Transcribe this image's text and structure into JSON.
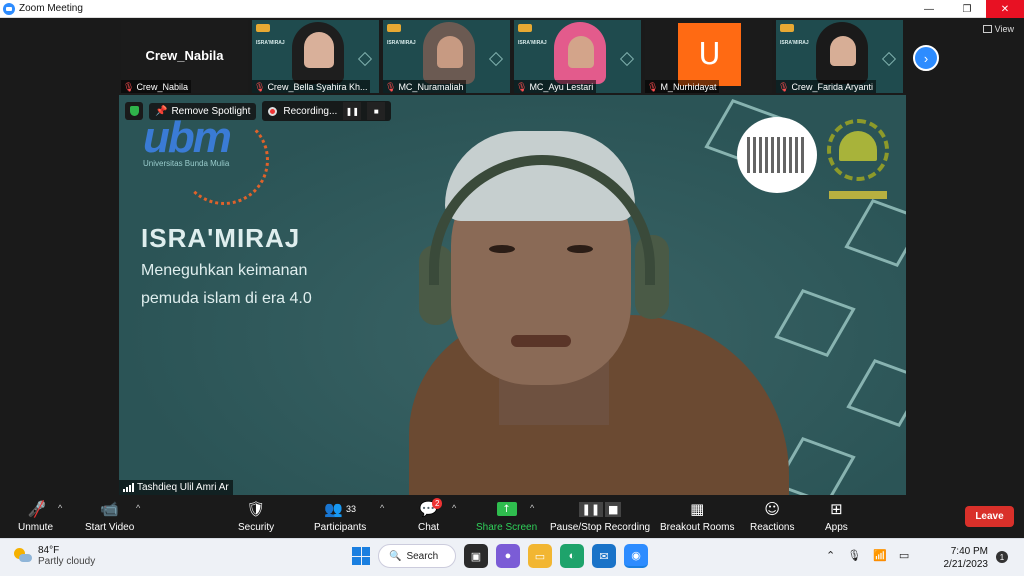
{
  "window": {
    "title": "Zoom Meeting",
    "minimize": "—",
    "maximize": "❐",
    "close": "✕"
  },
  "view_button": {
    "label": "View"
  },
  "thumbnails": [
    {
      "name": "Crew_Nabila",
      "label": "Crew_Nabila",
      "muted": true
    },
    {
      "name": "Crew_Bella Syahira Kh...",
      "muted": true
    },
    {
      "name": "MC_Nuramaliah",
      "muted": true
    },
    {
      "name": "MC_Ayu Lestari",
      "muted": true
    },
    {
      "name": "M_Nurhidayat",
      "avatar_letter": "U",
      "muted": true
    },
    {
      "name": "Crew_Farida Aryanti",
      "muted": true
    }
  ],
  "slide_thumb_text": "ISRA'MIRAJ",
  "next_page_icon": "›",
  "spotlight": {
    "remove_label": "Remove Spotlight",
    "recording_label": "Recording...",
    "pause_icon": "❚❚",
    "stop_icon": "■"
  },
  "main_video": {
    "speaker_name": "Tashdieq Ulil Amri Ar",
    "slide": {
      "logo_text": "ubm",
      "logo_sub": "Universitas Bunda Mulia",
      "title": "ISRA'MIRAJ",
      "subtitle_line1": "Meneguhkan keimanan",
      "subtitle_line2": "pemuda islam di era 4.0"
    }
  },
  "toolbar": {
    "unmute": "Unmute",
    "start_video": "Start Video",
    "security": "Security",
    "participants": "Participants",
    "participants_count": "33",
    "chat": "Chat",
    "chat_badge": "2",
    "share_screen": "Share Screen",
    "pause_stop_recording": "Pause/Stop Recording",
    "breakout_rooms": "Breakout Rooms",
    "reactions": "Reactions",
    "apps": "Apps",
    "leave": "Leave",
    "caret": "^"
  },
  "taskbar": {
    "temperature": "84°F",
    "weather": "Partly cloudy",
    "search_label": "Search",
    "time": "7:40 PM",
    "date": "2/21/2023",
    "notification_count": "1"
  },
  "colors": {
    "zoom_blue": "#2d8cff",
    "leave_red": "#d9302a",
    "share_green": "#2fbd4e",
    "slide_teal": "#2f5a5c"
  }
}
